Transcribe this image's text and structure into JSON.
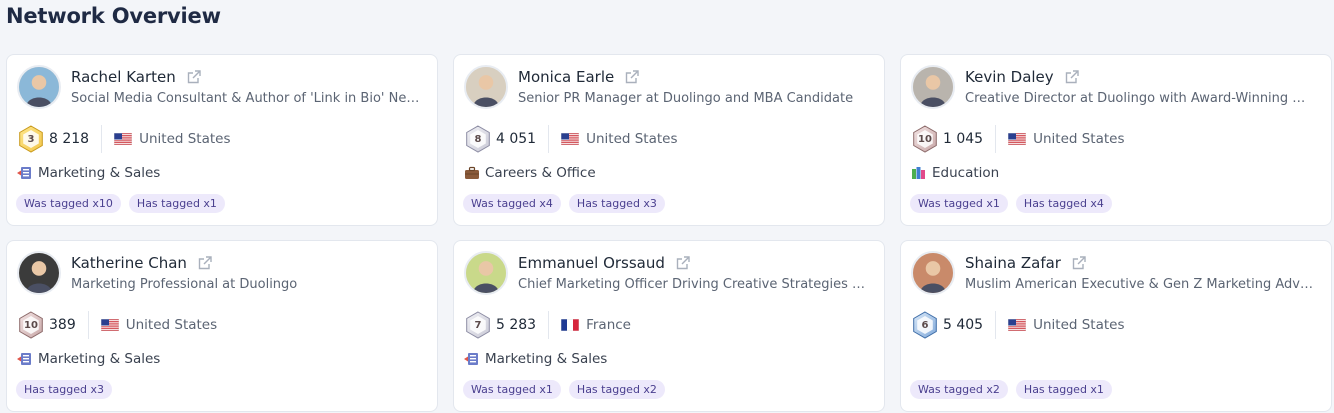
{
  "page": {
    "title": "Network Overview"
  },
  "icons": {
    "external_link": "external-link-icon",
    "level_badge": "hexagon-badge-icon"
  },
  "colors": {
    "tag_bg": "#ede9fb",
    "tag_text": "#4a3f8f",
    "badge_gold": "#f3c64a",
    "badge_bronze": "#c7a6a6",
    "badge_blue": "#7fa8d9"
  },
  "cards": [
    {
      "name": "Rachel Karten",
      "headline": "Social Media Consultant & Author of 'Link in Bio' Ne…",
      "level": "3",
      "level_color": "gold",
      "followers": "8 218",
      "country": "United States",
      "flag": "us-flag-icon",
      "category": "Marketing & Sales",
      "category_icon": "marketing-icon",
      "tags": [
        "Was tagged x10",
        "Has tagged x1"
      ]
    },
    {
      "name": "Monica Earle",
      "headline": "Senior PR Manager at Duolingo and MBA Candidate",
      "level": "8",
      "level_color": "silver",
      "followers": "4 051",
      "country": "United States",
      "flag": "us-flag-icon",
      "category": "Careers & Office",
      "category_icon": "briefcase-icon",
      "tags": [
        "Was tagged x4",
        "Has tagged x3"
      ]
    },
    {
      "name": "Kevin Daley",
      "headline": "Creative Director at Duolingo with Award-Winning …",
      "level": "10",
      "level_color": "bronze",
      "followers": "1 045",
      "country": "United States",
      "flag": "us-flag-icon",
      "category": "Education",
      "category_icon": "books-icon",
      "tags": [
        "Was tagged x1",
        "Has tagged x4"
      ]
    },
    {
      "name": "Katherine Chan",
      "headline": "Marketing Professional at Duolingo",
      "level": "10",
      "level_color": "bronze",
      "followers": "389",
      "country": "United States",
      "flag": "us-flag-icon",
      "category": "Marketing & Sales",
      "category_icon": "marketing-icon",
      "tags": [
        "Has tagged x3"
      ]
    },
    {
      "name": "Emmanuel Orssaud",
      "headline": "Chief Marketing Officer Driving Creative Strategies …",
      "level": "7",
      "level_color": "silver",
      "followers": "5 283",
      "country": "France",
      "flag": "fr-flag-icon",
      "category": "Marketing & Sales",
      "category_icon": "marketing-icon",
      "tags": [
        "Was tagged x1",
        "Has tagged x2"
      ]
    },
    {
      "name": "Shaina Zafar",
      "headline": "Muslim American Executive & Gen Z Marketing Adv…",
      "level": "6",
      "level_color": "blue",
      "followers": "5 405",
      "country": "United States",
      "flag": "us-flag-icon",
      "category": "",
      "category_icon": "",
      "tags": [
        "Was tagged x2",
        "Has tagged x1"
      ]
    }
  ]
}
